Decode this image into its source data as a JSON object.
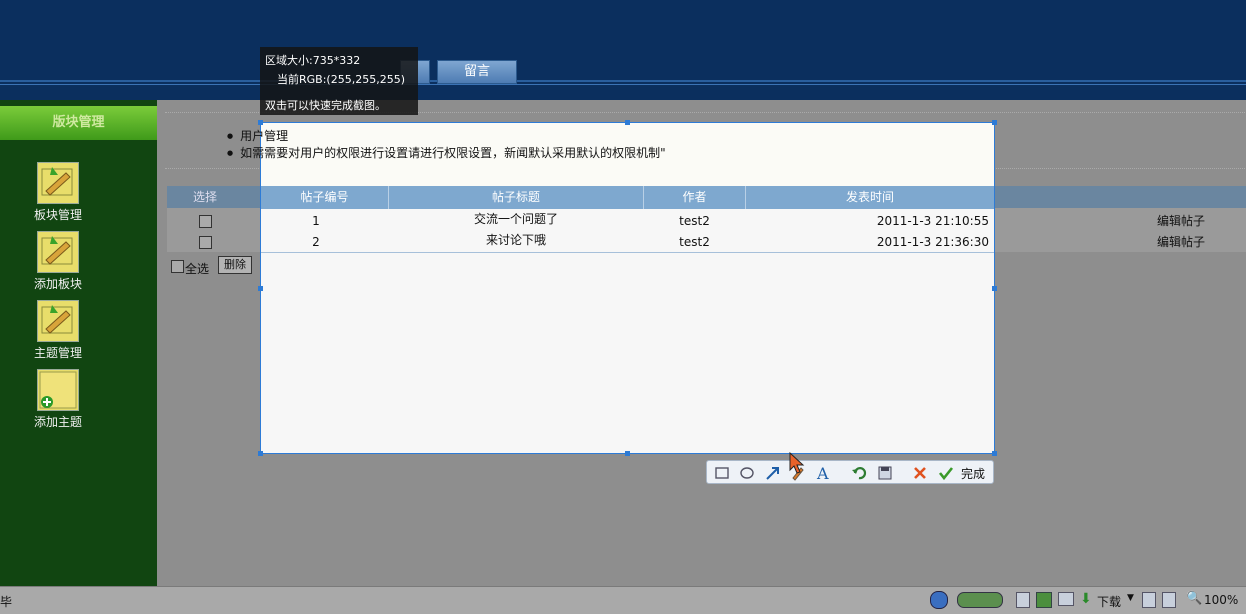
{
  "header": {
    "nav_tabs": [
      {
        "label": ""
      },
      {
        "label": "留言"
      }
    ]
  },
  "sidebar": {
    "title": "版块管理",
    "items": [
      {
        "label": "板块管理",
        "icon": "edit-board-icon"
      },
      {
        "label": "添加板块",
        "icon": "add-board-icon"
      },
      {
        "label": "主题管理",
        "icon": "edit-topic-icon"
      },
      {
        "label": "添加主题",
        "icon": "add-topic-icon"
      }
    ]
  },
  "notice": {
    "items": [
      "用户管理",
      "如需需要对用户的权限进行设置请进行权限设置，新闻默认采用默认的权限机制\""
    ]
  },
  "grid": {
    "select_header": "选择",
    "columns": [
      "帖子编号",
      "帖子标题",
      "作者",
      "发表时间"
    ],
    "rows": [
      {
        "id": "1",
        "title": "交流一个问题了",
        "author": "test2",
        "time": "2011-1-3 21:10:55",
        "action": "编辑帖子"
      },
      {
        "id": "2",
        "title": "来讨论下哦",
        "author": "test2",
        "time": "2011-1-3 21:36:30",
        "action": "编辑帖子"
      }
    ],
    "select_all_label": "全选",
    "delete_button": "删除"
  },
  "capture": {
    "size_text": "区域大小:735*332",
    "rgb_text": "当前RGB:(255,255,255)",
    "hint_text": "双击可以快速完成截图。",
    "toolbar": {
      "tools": [
        "rectangle-icon",
        "ellipse-icon",
        "arrow-icon",
        "brush-icon",
        "text-icon",
        "undo-icon",
        "save-icon",
        "cancel-icon"
      ],
      "done_label": "完成"
    }
  },
  "statusbar": {
    "left_text": "毕",
    "download_label": "下载",
    "zoom": "100%"
  },
  "colors": {
    "header": "#0b2f5e",
    "sidebar": "#114511",
    "region_border": "#2d7bd6",
    "grid_header": "#7ea8cf"
  }
}
